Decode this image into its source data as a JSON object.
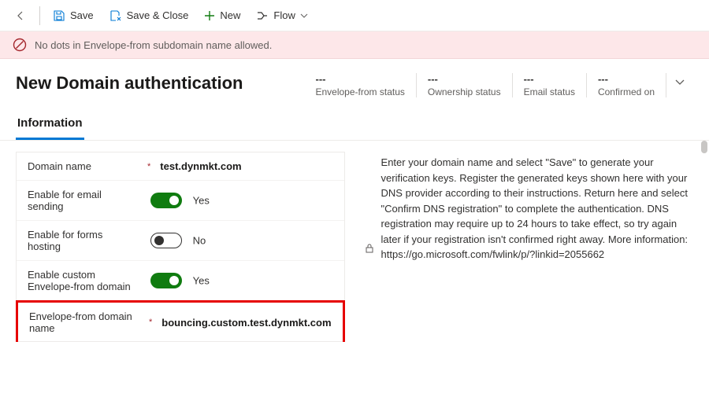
{
  "toolbar": {
    "save": "Save",
    "saveClose": "Save & Close",
    "new": "New",
    "flow": "Flow"
  },
  "error": {
    "message": "No dots in Envelope-from subdomain name allowed."
  },
  "title": "New Domain authentication",
  "status": {
    "placeholder": "---",
    "envelope": "Envelope-from status",
    "ownership": "Ownership status",
    "email": "Email status",
    "confirmed": "Confirmed on"
  },
  "tabs": {
    "information": "Information"
  },
  "form": {
    "domainName": {
      "label": "Domain name",
      "value": "test.dynmkt.com"
    },
    "emailSending": {
      "label": "Enable for email sending",
      "state": "Yes"
    },
    "formsHosting": {
      "label": "Enable for forms hosting",
      "state": "No"
    },
    "customEnvelope": {
      "label": "Enable custom Envelope-from domain",
      "state": "Yes"
    },
    "envelopeName": {
      "label": "Envelope-from domain name",
      "value": "bouncing.custom.test.dynmkt.com"
    },
    "required": "*"
  },
  "info": {
    "text": "Enter your domain name and select \"Save\" to generate your verification keys. Register the generated keys shown here with your DNS provider according to their instructions. Return here and select \"Confirm DNS registration\" to complete the authentication. DNS registration may require up to 24 hours to take effect, so try again later if your registration isn't confirmed right away. More information: https://go.microsoft.com/fwlink/p/?linkid=2055662"
  }
}
